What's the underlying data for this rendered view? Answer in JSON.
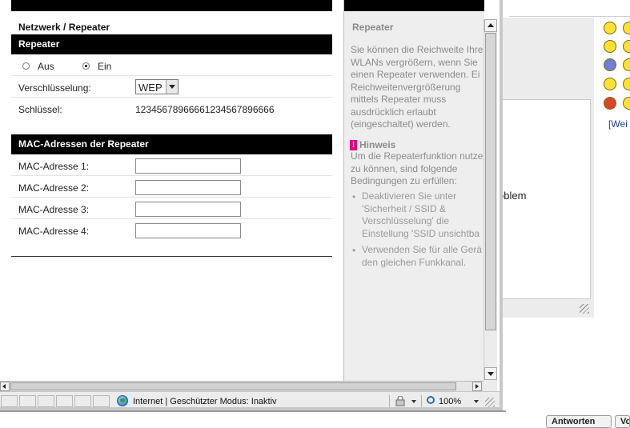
{
  "breadcrumb": "Netzwerk / Repeater",
  "repeater": {
    "heading": "Repeater",
    "option_off": "Aus",
    "option_on": "Ein",
    "selected": "Ein",
    "encryption_label": "Verschlüsselung:",
    "encryption_value": "WEP",
    "key_label": "Schlüssel:",
    "key_value": "12345678966661234567896666"
  },
  "mac": {
    "heading": "MAC-Adressen der Repeater",
    "rows": [
      {
        "label": "MAC-Adresse 1:",
        "value": ""
      },
      {
        "label": "MAC-Adresse 2:",
        "value": ""
      },
      {
        "label": "MAC-Adresse 3:",
        "value": ""
      },
      {
        "label": "MAC-Adresse 4:",
        "value": ""
      }
    ]
  },
  "help": {
    "title": "Repeater",
    "intro": "Sie können die Reichweite Ihre\nWLANs vergrößern, wenn Sie\neinen Repeater verwenden. Ei\nReichweitenvergrößerung\nmittels Repeater muss\nausdrücklich erlaubt\n(eingeschaltet) werden.",
    "hint_badge": "!",
    "hint_title": "Hinweis",
    "hint_text": "Um die Repeaterfunktion nutze\nzu können, sind folgende\nBedingungen zu erfüllen:",
    "bullets": [
      "Deaktivieren Sie unter\n'Sicherheit / SSID &\nVerschlüsselung' die\nEinstellung 'SSID unsichtba",
      "Verwenden Sie für alle Gerä\nden gleichen Funkkanal."
    ],
    "bullet_char": "•"
  },
  "statusbar": {
    "zone_text": "Internet | Geschützter Modus: Inaktiv",
    "zoom": "100%"
  },
  "background": {
    "text_fragment": "oblem",
    "link_fragment": "[Wei",
    "button_1": "Antworten",
    "button_2": "Vo"
  },
  "colors": {
    "header_bg": "#000000",
    "help_bg": "#eeeeee",
    "help_text": "#8b8b8b",
    "hint_accent": "#e2007a"
  }
}
